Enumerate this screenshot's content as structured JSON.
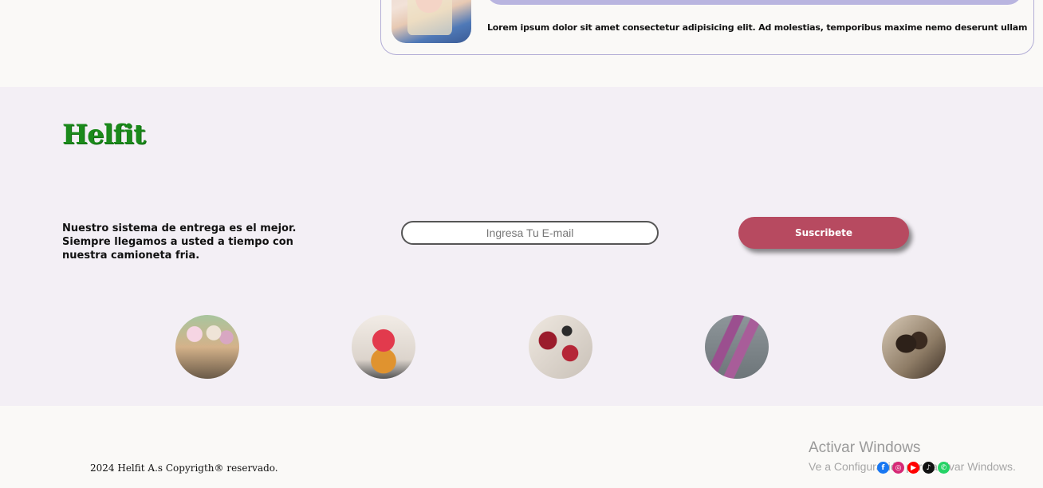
{
  "testimonial": {
    "text": "Lorem ipsum dolor sit amet consectetur adipisicing elit. Ad molestias, temporibus maxime nemo deserunt ullam eum providen"
  },
  "footer": {
    "logo": "Helfit",
    "delivery_text": "Nuestro sistema de entrega es el mejor. Siempre llegamos a usted a tiempo con nuestra camioneta fria.",
    "email_placeholder": "Ingresa Tu E-mail",
    "subscribe_label": "Suscribete",
    "gallery": [
      {
        "icon": "ice-cream-cones-photo"
      },
      {
        "icon": "strawberry-cupcake-photo"
      },
      {
        "icon": "berry-dessert-photo"
      },
      {
        "icon": "purple-popsicles-photo"
      },
      {
        "icon": "chocolate-bars-photo"
      }
    ]
  },
  "bottom": {
    "copyright": "2024 Helfit A.s Copyrigth® reservado.",
    "watermark_title": "Activar Windows",
    "watermark_sub": "Ve a Configuración para activar Windows.",
    "social_icons": [
      {
        "name": "facebook-icon",
        "glyph": "f",
        "color": "#1877f2"
      },
      {
        "name": "instagram-icon",
        "glyph": "◎",
        "color": "#d62976"
      },
      {
        "name": "youtube-icon",
        "glyph": "▶",
        "color": "#ff0000"
      },
      {
        "name": "tiktok-icon",
        "glyph": "♪",
        "color": "#111111"
      },
      {
        "name": "whatsapp-icon",
        "glyph": "✆",
        "color": "#25d366"
      }
    ]
  }
}
